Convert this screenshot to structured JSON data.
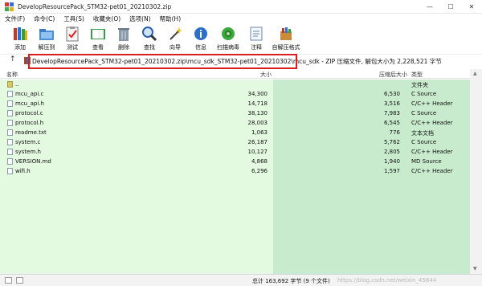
{
  "window": {
    "title": "DevelopResourcePack_STM32-pet01_20210302.zip",
    "controls": [
      "—",
      "☐",
      "✕"
    ]
  },
  "menu": [
    "文件(F)",
    "命令(C)",
    "工具(S)",
    "收藏夹(O)",
    "选项(N)",
    "帮助(H)"
  ],
  "toolbar": [
    {
      "label": "添加",
      "icon": "add-books-icon"
    },
    {
      "label": "解压到",
      "icon": "extract-folder-icon"
    },
    {
      "label": "测试",
      "icon": "test-clipboard-icon"
    },
    {
      "label": "查看",
      "icon": "view-book-icon"
    },
    {
      "label": "删除",
      "icon": "trash-icon"
    },
    {
      "label": "查找",
      "icon": "magnifier-icon"
    },
    {
      "label": "向导",
      "icon": "wizard-wand-icon"
    },
    {
      "label": "信息",
      "icon": "info-icon"
    },
    {
      "label": "扫描病毒",
      "icon": "virus-scan-icon"
    },
    {
      "label": "注释",
      "icon": "comment-icon"
    },
    {
      "label": "自解压格式",
      "icon": "sfx-box-icon"
    }
  ],
  "address": {
    "path": "DevelopResourcePack_STM32-pet01_20210302.zip\\mcu_sdk_STM32-pet01_20210302\\mcu_sdk - ZIP 压缩文件, 解包大小为 2,228,521 字节"
  },
  "columns": {
    "name": "名称",
    "size": "大小",
    "packed": "压缩后大小",
    "type": "类型"
  },
  "files": [
    {
      "name": "..",
      "size": "",
      "packed": "",
      "type": "文件夹",
      "folder": true
    },
    {
      "name": "mcu_api.c",
      "size": "34,300",
      "packed": "6,530",
      "type": "C Source"
    },
    {
      "name": "mcu_api.h",
      "size": "14,718",
      "packed": "3,516",
      "type": "C/C++ Header"
    },
    {
      "name": "protocol.c",
      "size": "38,130",
      "packed": "7,983",
      "type": "C Source"
    },
    {
      "name": "protocol.h",
      "size": "28,003",
      "packed": "6,545",
      "type": "C/C++ Header"
    },
    {
      "name": "readme.txt",
      "size": "1,063",
      "packed": "776",
      "type": "文本文档"
    },
    {
      "name": "system.c",
      "size": "26,187",
      "packed": "5,762",
      "type": "C Source"
    },
    {
      "name": "system.h",
      "size": "10,127",
      "packed": "2,805",
      "type": "C/C++ Header"
    },
    {
      "name": "VERSION.md",
      "size": "4,868",
      "packed": "1,940",
      "type": "MD Source"
    },
    {
      "name": "wifi.h",
      "size": "6,296",
      "packed": "1,597",
      "type": "C/C++ Header"
    }
  ],
  "status": {
    "text": "总计 163,692 字节 (9 个文件)",
    "watermark": "https://blog.csdn.net/weixin_45844"
  },
  "colors": {
    "highlight_box": "#d81e1e",
    "list_bg": "#e4fae0",
    "column_bg": "#c9ebcd"
  }
}
